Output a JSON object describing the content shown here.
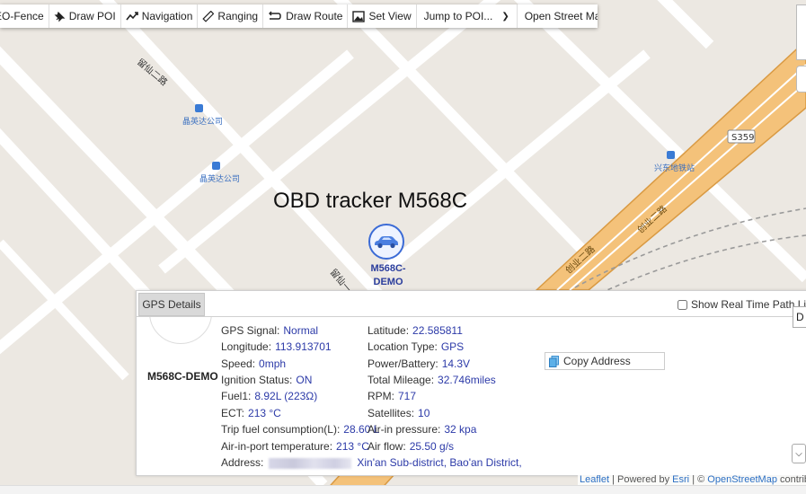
{
  "toolbar": {
    "items": [
      {
        "label": "EO-Fence",
        "icon": "geofence-icon"
      },
      {
        "label": "Draw POI",
        "icon": "pin-icon"
      },
      {
        "label": "Navigation",
        "icon": "navigation-icon"
      },
      {
        "label": "Ranging",
        "icon": "ruler-icon"
      },
      {
        "label": "Draw Route",
        "icon": "route-icon"
      },
      {
        "label": "Set View",
        "icon": "picture-icon"
      }
    ],
    "jump_to_poi": "Jump to POI...",
    "map_source": "Open Street Map"
  },
  "map": {
    "title": "OBD tracker M568C",
    "road_badge": "S359",
    "labels": {
      "road_top_left": "留仙二路",
      "road_mid_left": "留仙一",
      "road_main_1": "创业二路",
      "road_main_2": "创业二路",
      "bus_stop_1": "晶英达公司",
      "bus_stop_2": "晶英达公司",
      "metro_station": "兴东地铁站"
    },
    "marker_label": "M568C-DEMO",
    "colors": {
      "background": "#ece8e2",
      "street": "#ffffff",
      "main_road_fill": "#f4c27a",
      "main_road_border": "#d99a43",
      "marker_border": "#3b6bd6",
      "value_text": "#2c3aa8"
    }
  },
  "panel": {
    "tab": "GPS Details",
    "show_realtime": "Show Real Time Path Line",
    "device_name": "M568C-DEMO",
    "copy_address": "Copy Address",
    "col1": [
      {
        "label": "GPS Signal:",
        "value": "Normal"
      },
      {
        "label": "Longitude:",
        "value": "113.913701"
      },
      {
        "label": "Speed:",
        "value": "0mph"
      },
      {
        "label": "Ignition Status:",
        "value": "ON"
      },
      {
        "label": "Fuel1:",
        "value": "8.92L (223Ω)"
      },
      {
        "label": "ECT:",
        "value": "213 °C"
      },
      {
        "label": "Trip fuel consumption(L):",
        "value": "28.60 L"
      },
      {
        "label": "Air-in-port temperature:",
        "value": "213 °C"
      }
    ],
    "col2": [
      {
        "label": "Latitude:",
        "value": "22.585811"
      },
      {
        "label": "Location Type:",
        "value": "GPS"
      },
      {
        "label": "Power/Battery:",
        "value": "14.3V"
      },
      {
        "label": "Total Mileage:",
        "value": "32.746miles"
      },
      {
        "label": "RPM:",
        "value": "717"
      },
      {
        "label": "Satellites:",
        "value": "10"
      },
      {
        "label": "Air-in pressure:",
        "value": "32 kpa"
      },
      {
        "label": "Air flow:",
        "value": "25.50 g/s"
      }
    ],
    "address_label": "Address:",
    "address_value": "Xin'an Sub-district, Bao'an District,"
  },
  "attribution": {
    "leaflet": "Leaflet",
    "powered_by": "Powered by",
    "esri": "Esri",
    "copyright": "©",
    "osm": "OpenStreetMap",
    "contrib": "contrib"
  },
  "side_button": "D"
}
